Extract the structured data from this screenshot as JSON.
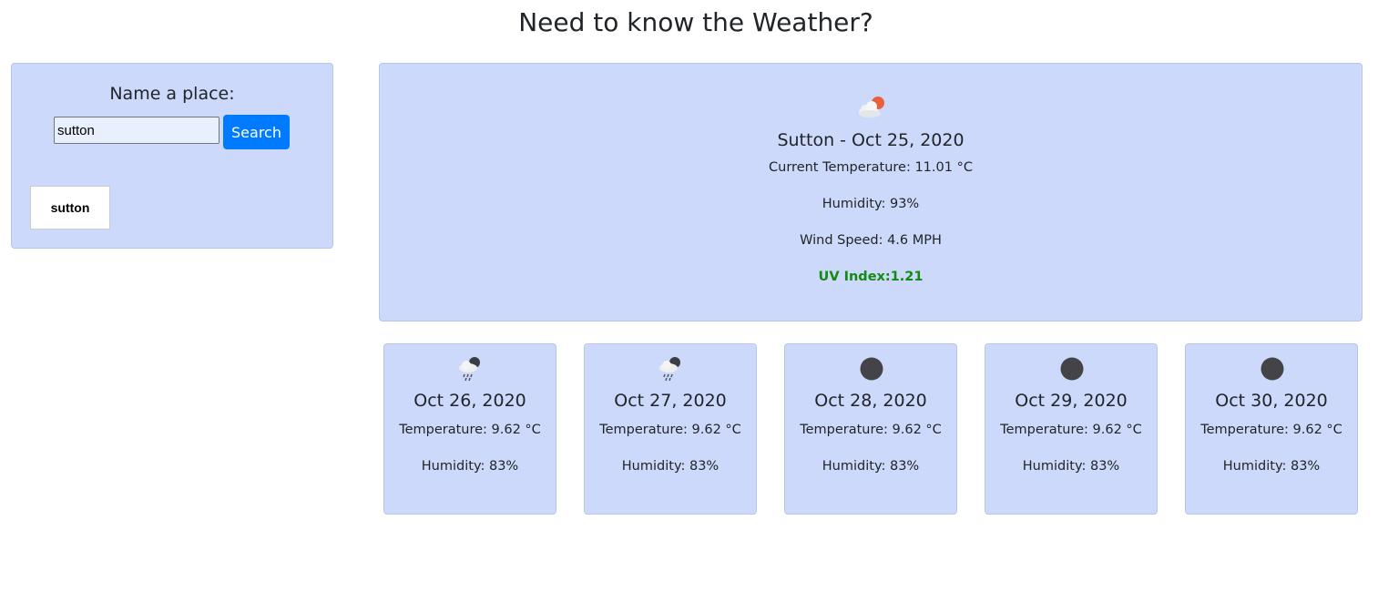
{
  "page": {
    "title": "Need to know the Weather?"
  },
  "search": {
    "heading": "Name a place:",
    "value": "sutton",
    "button_label": "Search",
    "history": [
      "sutton"
    ]
  },
  "current": {
    "icon": "partly-cloudy-day-icon",
    "city_date": "Sutton - Oct 25, 2020",
    "temperature": "Current Temperature: 11.01 °C",
    "humidity": "Humidity: 93%",
    "wind": "Wind Speed: 4.6 MPH",
    "uv": "UV Index:1.21",
    "uv_color": "#138a13"
  },
  "forecast": [
    {
      "icon": "rain-cloud-icon",
      "date": "Oct 26, 2020",
      "temperature": "Temperature: 9.62 °C",
      "humidity": "Humidity: 83%"
    },
    {
      "icon": "rain-cloud-icon",
      "date": "Oct 27, 2020",
      "temperature": "Temperature: 9.62 °C",
      "humidity": "Humidity: 83%"
    },
    {
      "icon": "dark-circle-icon",
      "date": "Oct 28, 2020",
      "temperature": "Temperature: 9.62 °C",
      "humidity": "Humidity: 83%"
    },
    {
      "icon": "dark-circle-icon",
      "date": "Oct 29, 2020",
      "temperature": "Temperature: 9.62 °C",
      "humidity": "Humidity: 83%"
    },
    {
      "icon": "dark-circle-icon",
      "date": "Oct 30, 2020",
      "temperature": "Temperature: 9.62 °C",
      "humidity": "Humidity: 83%"
    }
  ],
  "colors": {
    "panel": "#ccd9fa",
    "button": "#007bff",
    "uv_low": "#138a13"
  }
}
